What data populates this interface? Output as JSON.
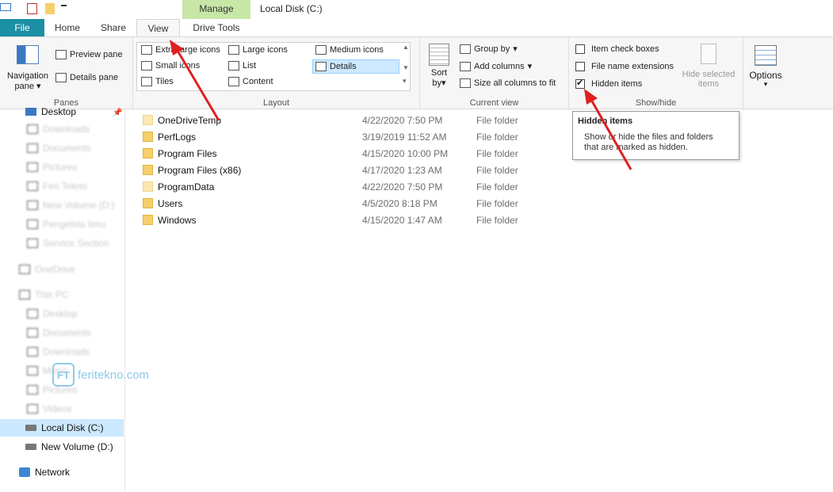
{
  "window": {
    "title": "Local Disk (C:)",
    "context_tab_group": "Manage"
  },
  "tabs": {
    "file": "File",
    "home": "Home",
    "share": "Share",
    "view": "View",
    "drive_tools": "Drive Tools"
  },
  "ribbon": {
    "panes": {
      "label": "Panes",
      "navigation_pane_1": "Navigation",
      "navigation_pane_2": "pane",
      "preview_pane": "Preview pane",
      "details_pane": "Details pane"
    },
    "layout": {
      "label": "Layout",
      "extra_large_icons": "Extra large icons",
      "large_icons": "Large icons",
      "medium_icons": "Medium icons",
      "small_icons": "Small icons",
      "list": "List",
      "details": "Details",
      "tiles": "Tiles",
      "content": "Content"
    },
    "current_view": {
      "label": "Current view",
      "sort_by_1": "Sort",
      "sort_by_2": "by",
      "group_by": "Group by",
      "add_columns": "Add columns",
      "size_columns": "Size all columns to fit"
    },
    "show_hide": {
      "label": "Show/hide",
      "item_check_boxes": "Item check boxes",
      "item_check_boxes_checked": false,
      "file_name_extensions": "File name extensions",
      "file_name_extensions_checked": false,
      "hidden_items": "Hidden items",
      "hidden_items_checked": true,
      "hide_selected_1": "Hide selected",
      "hide_selected_2": "items"
    },
    "options": {
      "label": "Options"
    }
  },
  "tooltip": {
    "title": "Hidden items",
    "body_1": "Show or hide the files and folders",
    "body_2": "that are marked as hidden."
  },
  "nav": {
    "desktop": "Desktop",
    "blurred": [
      "Downloads",
      "Documents",
      "Pictures",
      "Feri Tekno",
      "New Volume (D:)",
      "Pengelola Ilmu",
      "Service Section",
      "OneDrive",
      "This PC",
      "Desktop",
      "Documents",
      "Downloads",
      "Music",
      "Pictures",
      "Videos"
    ],
    "local_disk": "Local Disk (C:)",
    "new_volume": "New Volume (D:)",
    "network": "Network"
  },
  "files": [
    {
      "name": "OneDriveTemp",
      "date": "4/22/2020 7:50 PM",
      "type": "File folder",
      "hidden": true
    },
    {
      "name": "PerfLogs",
      "date": "3/19/2019 11:52 AM",
      "type": "File folder",
      "hidden": false
    },
    {
      "name": "Program Files",
      "date": "4/15/2020 10:00 PM",
      "type": "File folder",
      "hidden": false
    },
    {
      "name": "Program Files (x86)",
      "date": "4/17/2020 1:23 AM",
      "type": "File folder",
      "hidden": false
    },
    {
      "name": "ProgramData",
      "date": "4/22/2020 7:50 PM",
      "type": "File folder",
      "hidden": true
    },
    {
      "name": "Users",
      "date": "4/5/2020 8:18 PM",
      "type": "File folder",
      "hidden": false
    },
    {
      "name": "Windows",
      "date": "4/15/2020 1:47 AM",
      "type": "File folder",
      "hidden": false
    }
  ],
  "watermark": {
    "logo_text": "FT",
    "text": "feritekno.com"
  },
  "colors": {
    "file_tab": "#1b8fa4",
    "manage_tab": "#c7e7a7",
    "selection": "#cce8ff",
    "arrow": "#e02020"
  }
}
